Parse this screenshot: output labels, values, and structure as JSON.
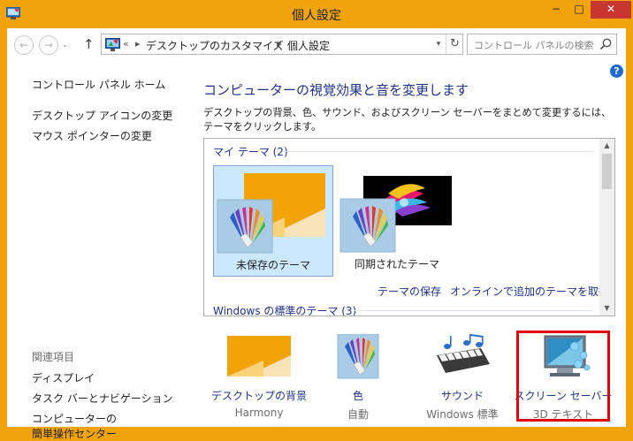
{
  "window": {
    "title": "個人設定",
    "minimize": "−",
    "maximize": "□",
    "close": "✕"
  },
  "nav": {
    "back": "←",
    "forward": "→",
    "history": "⌄",
    "up": "↑",
    "breadcrumb": [
      "デスクトップのカスタマイズ",
      "個人設定"
    ],
    "separator": "▸",
    "overflow": "«",
    "refresh": "↻",
    "search_placeholder": "コントロール パネルの検索"
  },
  "help_label": "?",
  "sidebar": {
    "home": "コントロール パネル ホーム",
    "links": [
      "デスクトップ アイコンの変更",
      "マウス ポインターの変更"
    ],
    "related_heading": "関連項目",
    "related": [
      "ディスプレイ",
      "タスク バーとナビゲーション",
      "コンピューターの",
      "簡単操作センター"
    ]
  },
  "main": {
    "title": "コンピューターの視覚効果と音を変更します",
    "description": "デスクトップの背景、色、サウンド、およびスクリーン セーバーをまとめて変更するには、テーマをクリックします。"
  },
  "themes": {
    "my_group": "マイ テーマ (2)",
    "items": [
      {
        "label": "未保存のテーマ",
        "selected": true
      },
      {
        "label": "同期されたテーマ",
        "selected": false
      }
    ],
    "save_link": "テーマの保存",
    "online_link": "オンラインで追加のテーマを取得",
    "windows_group": "Windows の標準のテーマ (3)"
  },
  "bottom": [
    {
      "label": "デスクトップの背景",
      "sub": "Harmony",
      "icon": "wallpaper-icon"
    },
    {
      "label": "色",
      "sub": "自動",
      "icon": "color-palette-icon"
    },
    {
      "label": "サウンド",
      "sub": "Windows 標準",
      "icon": "sound-icon"
    },
    {
      "label": "スクリーン セーバー",
      "sub": "3D テキスト",
      "icon": "screensaver-icon"
    }
  ],
  "colors": {
    "accent_frame": "#f0a30a",
    "link": "#1e3287",
    "highlight_box": "#e0000e"
  }
}
